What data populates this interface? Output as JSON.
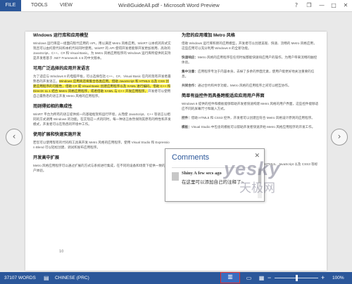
{
  "ribbon": {
    "file": "FILE",
    "tools": "TOOLS",
    "view": "VIEW",
    "title": "Win8GuideAll.pdf - Microsoft Word Preview",
    "help": "?",
    "restore": "❐",
    "minimize": "—",
    "maximize": "□",
    "close": "✕"
  },
  "nav": {
    "prev": "‹",
    "next": "›"
  },
  "document": {
    "left": {
      "h1": "Windows 运行库和应用模型",
      "p1": "Windows 运行库是一组面向现代应用的 API，用以满足 Metro 风格应用。WinRT 以本机的形式实现且可以由托管代码和本机代码同时使用。WinRT 的 API 使得开发者能够开发更加易用、高效的 JavaScript、C++、C# 和 Visual Basic。为 Metro 风格应用程序的 Windows 运行库所提供的支持是开发者基于 .NET Framework 4.5 的中文版本。",
      "h2": "可用广泛选择的应用开发语言",
      "p2a": "为了适应与 Windows 8 的电脑平板，可以选择包括 C++、C#、Visual Basic 在内的现有开发者最熟悉的开发语言，",
      "p2hl": "Windows 应用商店将集合各类应用。借助 JavaScript 和 HTML5 以及 CSS 创建应用程序的可能性，借助 C# 或 Visual Basic 创建应用程序以及 XAML 进行编码，借助 C++ 和 DirectX 11.1 结合 Metro 风格应用程序，或者借助 XAML 与 C++ 开发应用程序。",
      "p2b": "开发者可以使用自己最熟悉的语言开发 Metro 风格的应用程序。",
      "h3": "而则得如相的集成性",
      "p3": "WinRT 平台为所有的语言提供统一的基础框架和运行环境，从而使 JavaScript、C++ 等语言以相同的方式调用 Windows 的功能。在实现这一点的同时，每一种语言依然保持其原有的特性和开发模式，开发者可以在熟悉的环境中工作。",
      "h4": "使用扩展和快速实施开发",
      "p4": "若您可以使用现有的代码和工具来开发 Metro 风格的应用程序。使用 Visual Studio 和 Expression Blend 可以轻松创建、调试和发布应用程序。",
      "h5": "开发高中扩展",
      "p5": "Metro 风格应用程序可以通过扩展的方式与系统进行集成，在不同的设备和场景下提供一致的用户体验。",
      "page_number": "10"
    },
    "right": {
      "h1": "为您的应用增加 Metro 风格",
      "p1": "借助 Windows 运行库和新的应用模型，开发者可以创建美观、快速、流畅的 Metro 风格应用，这些应用可以充分利用 Windows 8 的全新功能。",
      "lead1": "快速响应：",
      "p2": "Metro 风格的应用程序在任何时候都能快速响应用户的操作，为用户带来流畅的触控体验。",
      "lead2": "集中注意：",
      "p3": "应用程序专注于内容本身，去掉了多余的界面元素，使用户能更好地关注重要的信息。",
      "lead3": "共同合作：",
      "p4": "通过合约和共享功能，Metro 风格的应用程序之间可以相互协作。",
      "h2": "简单有益控件而具备跨能适应应用用户界面",
      "p5": "Windows 8 提供的控件和模板能够帮助开发者快速构建 Metro 风格的用户界面，这些控件能够适应不同的屏幕尺寸和输入方式。",
      "lead4": "控件：",
      "p6": "借助 HTML5 和 CSS3 控件，开发者可以创建出符合 Metro 风格设计原则的应用程序。",
      "lead5": "模板：",
      "p7": "Visual Studio 中包含的模板可以帮助开发者快速开始 Metro 风格应用程序的开发工作。",
      "p8": "Windows 运行库中的 JavaScript 支持与 Chrome 浏览器、HTML5、JavaScript 以及 CSS3 等标准技术的完美结合。"
    }
  },
  "comments": {
    "title": "Comments",
    "close": "✕",
    "author": "Shiny A few secs ago",
    "text": "在这里可以添加自己的注释了~"
  },
  "watermark": {
    "main": "yesky",
    "sub": "天极网"
  },
  "status": {
    "words": "37107 WORDS",
    "language": "CHINESE (PRC)",
    "zoom_minus": "−",
    "zoom_plus": "+",
    "zoom": "100%",
    "zoom_fraction": 0.5
  }
}
